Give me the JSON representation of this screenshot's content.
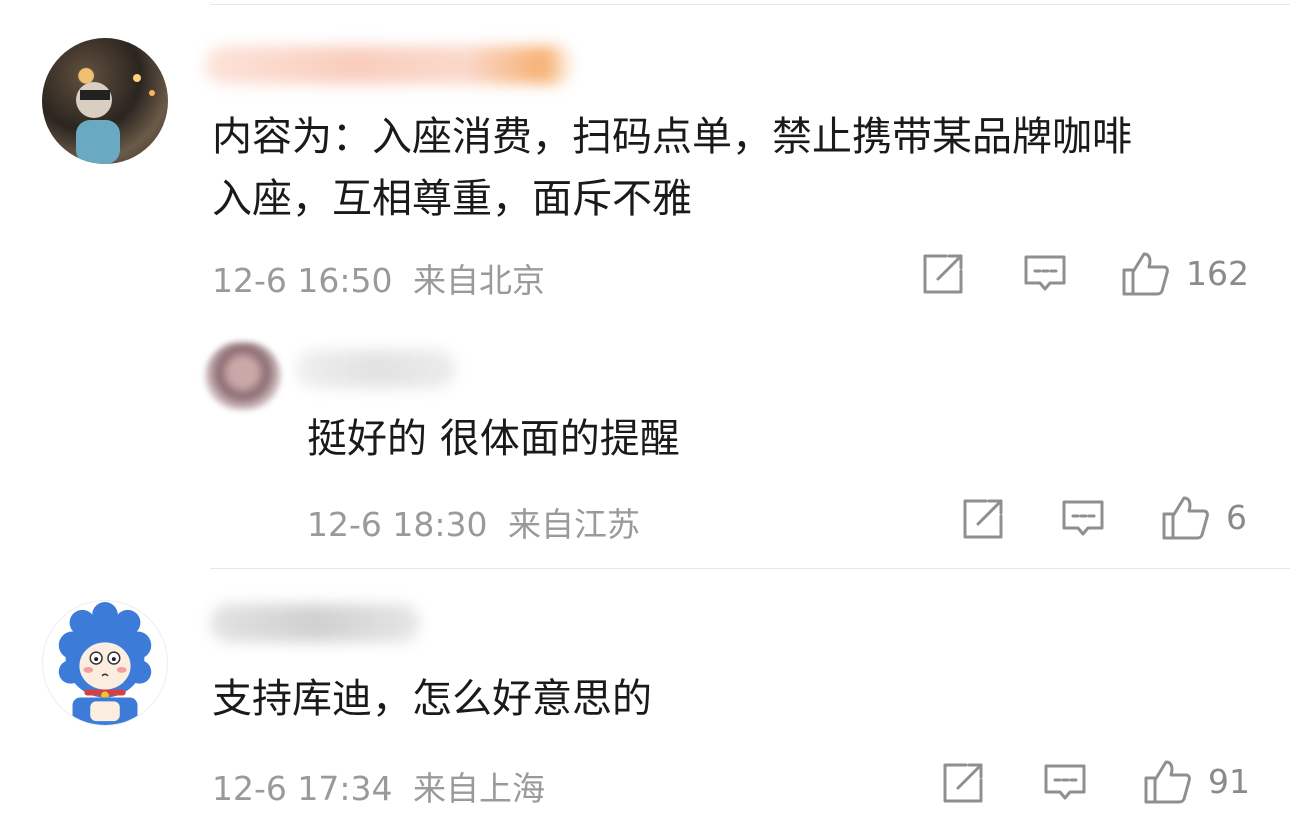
{
  "comments": [
    {
      "text_lines": [
        "内容为：入座消费，扫码点单，禁止携带某品牌咖啡",
        "入座，互相尊重，面斥不雅"
      ],
      "time": "12-6 16:50",
      "location": "来自北京",
      "likes": "162",
      "reply": {
        "text": "挺好的 很体面的提醒",
        "time": "12-6 18:30",
        "location": "来自江苏",
        "likes": "6"
      }
    },
    {
      "text_lines": [
        "支持库迪，怎么好意思的"
      ],
      "time": "12-6 17:34",
      "location": "来自上海",
      "likes": "91"
    }
  ],
  "icons": {
    "share": "share-icon",
    "comment": "comment-icon",
    "like": "thumbs-up-icon"
  },
  "colors": {
    "text": "#1a1a1a",
    "meta": "#9a9a9a",
    "divider": "#e6e6e6",
    "avatar_blue": "#3d7bd9"
  }
}
